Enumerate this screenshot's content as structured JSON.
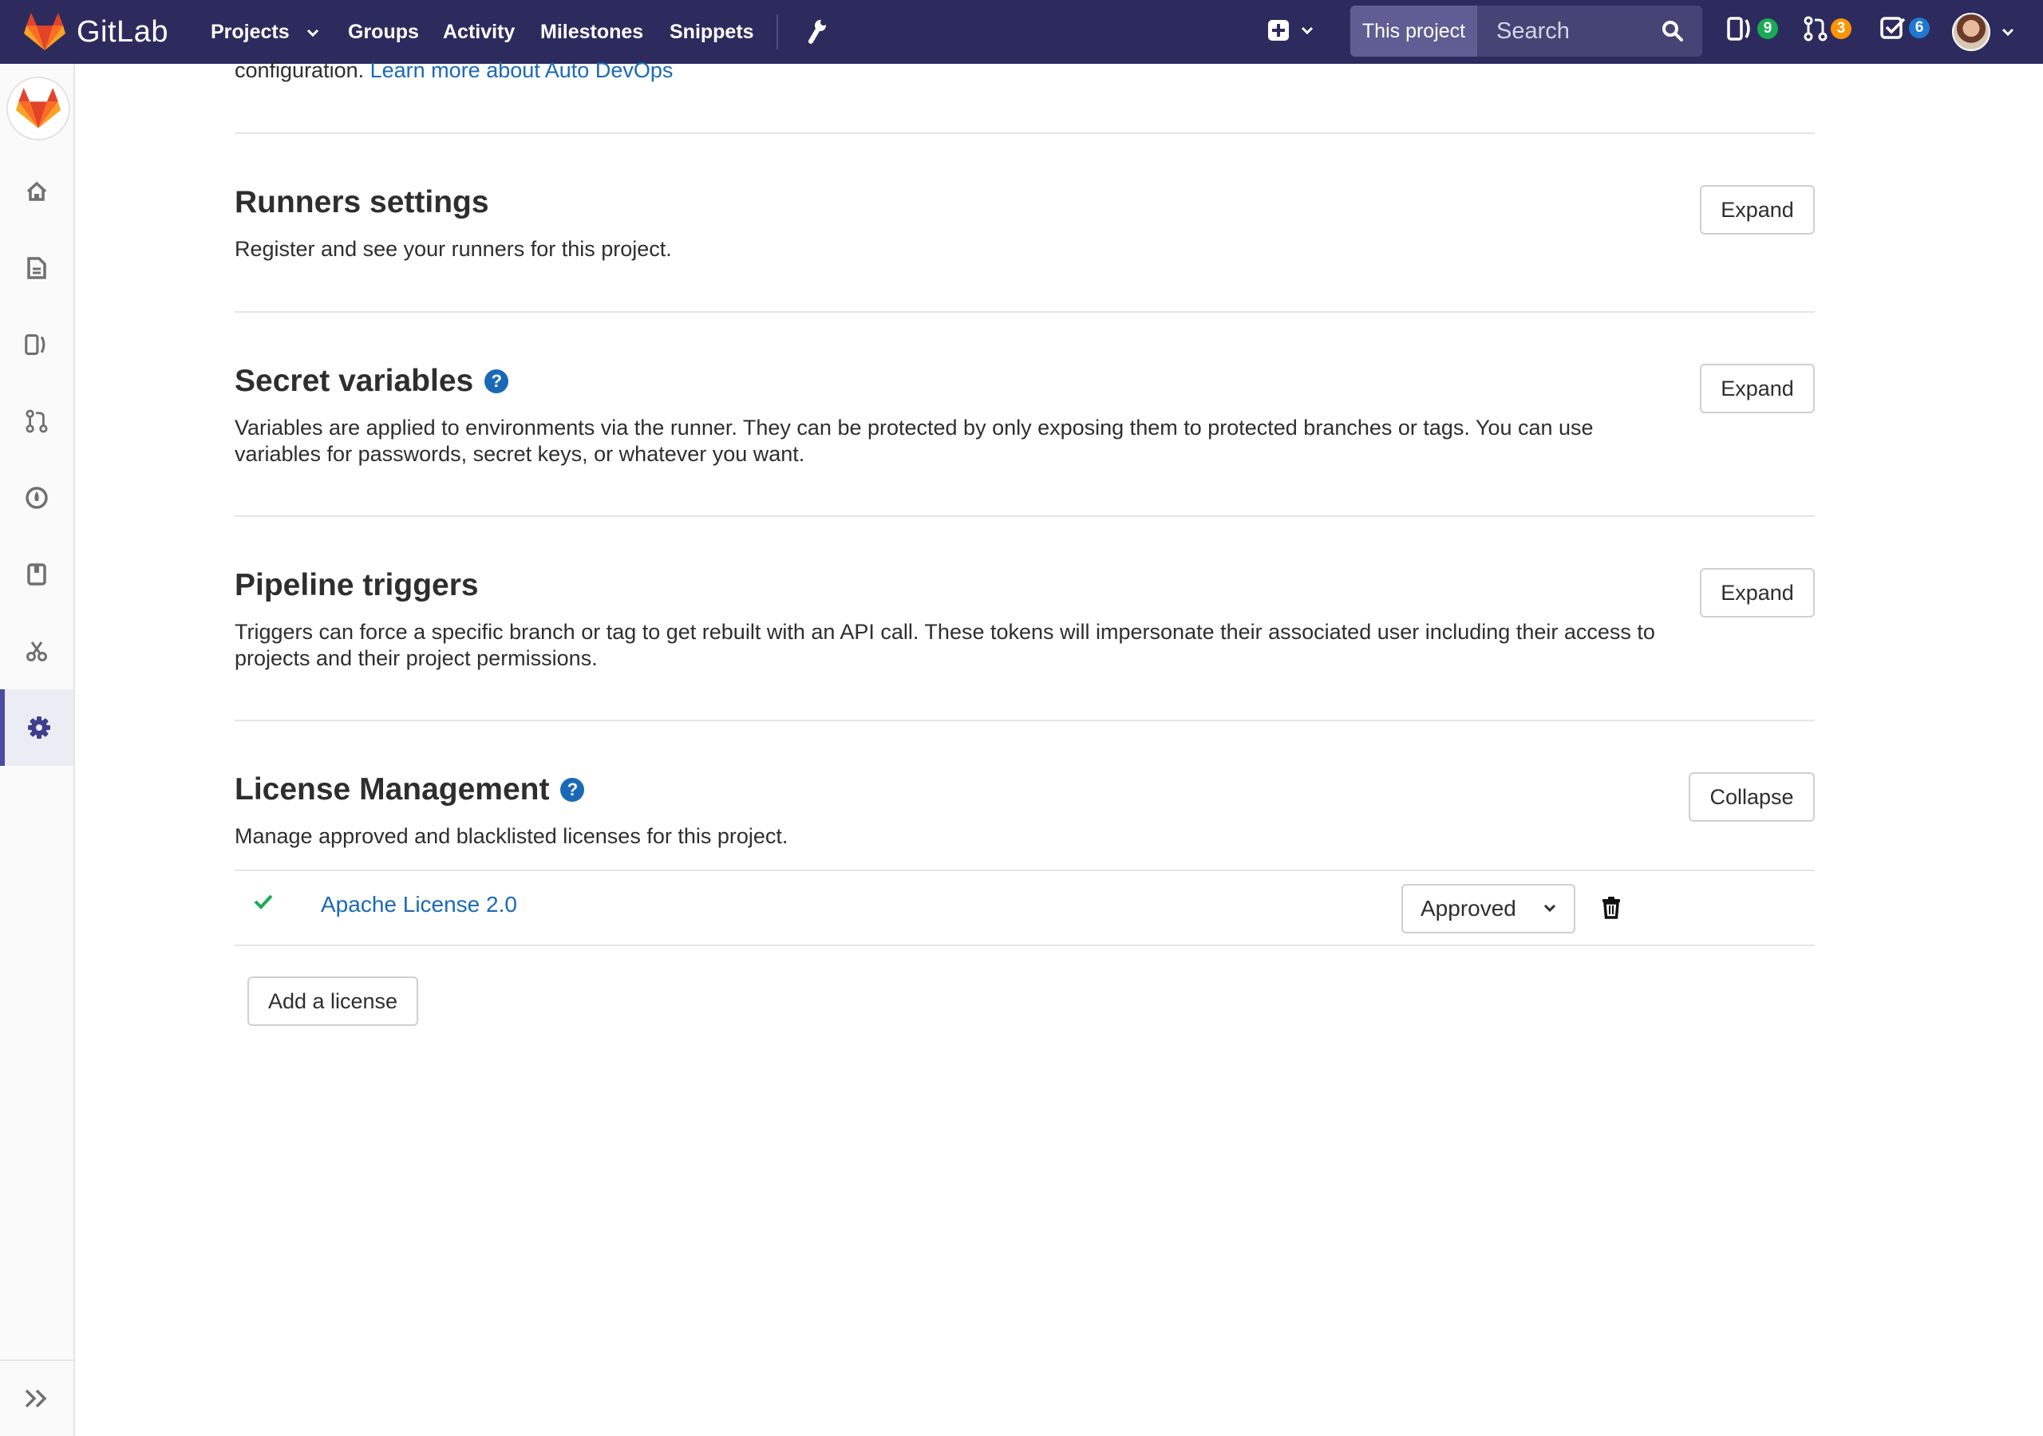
{
  "navbar": {
    "brand": "GitLab",
    "links": [
      {
        "label": "Projects",
        "has_dropdown": true
      },
      {
        "label": "Groups"
      },
      {
        "label": "Activity"
      },
      {
        "label": "Milestones"
      },
      {
        "label": "Snippets"
      }
    ],
    "search": {
      "scope": "This project",
      "placeholder": "Search"
    },
    "counters": {
      "issues": "9",
      "merge_requests": "3",
      "todos": "6"
    },
    "colors": {
      "bar": "#2d2b5e",
      "issues_badge": "#1aaa55",
      "mr_badge": "#fc9403",
      "todos_badge": "#1f78d1"
    }
  },
  "sidebar": {
    "items": [
      {
        "icon": "home-icon",
        "label": "Project"
      },
      {
        "icon": "document-icon",
        "label": "Repository"
      },
      {
        "icon": "issues-icon",
        "label": "Issues"
      },
      {
        "icon": "merge-request-icon",
        "label": "Merge Requests"
      },
      {
        "icon": "rocket-icon",
        "label": "CI / CD"
      },
      {
        "icon": "book-icon",
        "label": "Wiki"
      },
      {
        "icon": "snippets-icon",
        "label": "Snippets"
      },
      {
        "icon": "gear-icon",
        "label": "Settings",
        "active": true
      }
    ],
    "collapse_icon": "double-chevron-right-icon"
  },
  "main": {
    "intro_text": "configuration.",
    "intro_link": "Learn more about Auto DevOps",
    "sections": [
      {
        "title": "Runners settings",
        "description": "Register and see your runners for this project.",
        "button": "Expand",
        "help": false
      },
      {
        "title": "Secret variables",
        "description": "Variables are applied to environments via the runner. They can be protected by only exposing them to protected branches or tags. You can use variables for passwords, secret keys, or whatever you want.",
        "button": "Expand",
        "help": true
      },
      {
        "title": "Pipeline triggers",
        "description": "Triggers can force a specific branch or tag to get rebuilt with an API call. These tokens will impersonate their associated user including their access to projects and their project permissions.",
        "button": "Expand",
        "help": false
      },
      {
        "title": "License Management",
        "description": "Manage approved and blacklisted licenses for this project.",
        "button": "Collapse",
        "help": true
      }
    ],
    "licenses": [
      {
        "name": "Apache License 2.0",
        "status": "Approved",
        "status_icon": "check-icon"
      }
    ],
    "add_license_button": "Add a license"
  }
}
